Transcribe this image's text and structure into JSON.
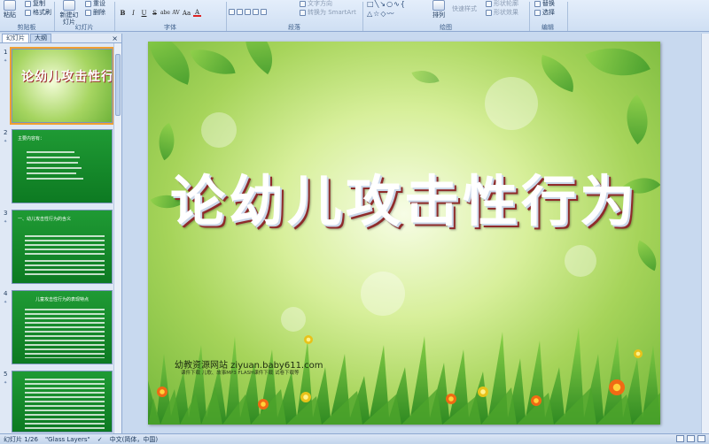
{
  "ribbon": {
    "clipboard": {
      "paste": "粘贴",
      "copy": "复制",
      "format_painter": "格式刷",
      "group": "剪贴板"
    },
    "slides": {
      "new_slide": "新建幻灯片",
      "layout": "版式",
      "reset": "重设",
      "delete": "删除",
      "group": "幻灯片"
    },
    "font": {
      "group": "字体",
      "bold": "B",
      "italic": "I",
      "underline": "U",
      "strike": "S",
      "shadow": "abe",
      "spacing": "AV",
      "case": "Aa",
      "color": "A"
    },
    "paragraph": {
      "group": "段落",
      "text_direction": "文字方向",
      "align_text": "对齐文本",
      "smartart": "转换为 SmartArt"
    },
    "drawing": {
      "group": "绘图",
      "arrange": "排列",
      "quick_styles": "快速样式",
      "shape_fill": "形状填充",
      "shape_outline": "形状轮廓",
      "shape_effects": "形状效果"
    },
    "editing": {
      "group": "编辑",
      "find": "查找",
      "replace": "替换",
      "select": "选择"
    }
  },
  "left_pane": {
    "tab_slides": "幻灯片",
    "tab_outline": "大纲",
    "close": "×",
    "thumbnails": [
      {
        "num": "1",
        "title": "论幼儿攻击性行为"
      },
      {
        "num": "2",
        "title": "主要内容有："
      },
      {
        "num": "3",
        "title": "一、幼儿攻击性行为的含义"
      },
      {
        "num": "4",
        "title": "儿童攻击性行为的表现特点"
      },
      {
        "num": "5",
        "title": ""
      }
    ]
  },
  "slide": {
    "title": "论幼儿攻击性行为",
    "site_name": "幼教资源网站  ziyuan.baby611.com",
    "site_sub": "课件下载  儿歌、故事MP3  FLASH课件下载  试卷下载等"
  },
  "status_bar": {
    "slide_count": "幻灯片 1/26",
    "theme": "\"Glass Layers\"",
    "language": "中文(简体，中国)"
  },
  "colors": {
    "ribbon_bg": "#dbe6f5",
    "thumb_green": "#1a8f2e",
    "title_shadow": "#8f2b2b",
    "selection": "#f0a030"
  }
}
